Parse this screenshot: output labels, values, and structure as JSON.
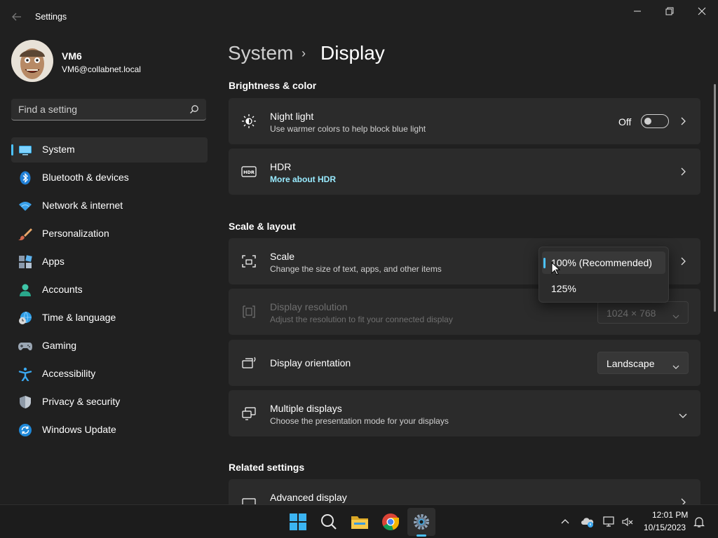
{
  "window": {
    "title": "Settings"
  },
  "profile": {
    "name": "VM6",
    "email": "VM6@collabnet.local"
  },
  "search": {
    "placeholder": "Find a setting",
    "icon": "search-icon"
  },
  "nav": {
    "items": [
      {
        "label": "System",
        "icon": "system-icon",
        "active": true
      },
      {
        "label": "Bluetooth & devices",
        "icon": "bluetooth-icon"
      },
      {
        "label": "Network & internet",
        "icon": "wifi-icon"
      },
      {
        "label": "Personalization",
        "icon": "brush-icon"
      },
      {
        "label": "Apps",
        "icon": "apps-icon"
      },
      {
        "label": "Accounts",
        "icon": "person-icon"
      },
      {
        "label": "Time & language",
        "icon": "globe-clock-icon"
      },
      {
        "label": "Gaming",
        "icon": "gamepad-icon"
      },
      {
        "label": "Accessibility",
        "icon": "accessibility-icon"
      },
      {
        "label": "Privacy & security",
        "icon": "shield-icon"
      },
      {
        "label": "Windows Update",
        "icon": "update-icon"
      }
    ]
  },
  "breadcrumb": {
    "parent": "System",
    "separator": "›",
    "current": "Display"
  },
  "sections": {
    "brightness": "Brightness & color",
    "scale_layout": "Scale & layout",
    "related": "Related settings"
  },
  "cards": {
    "night_light": {
      "title": "Night light",
      "subtitle": "Use warmer colors to help block blue light",
      "state": "Off",
      "toggle_on": false
    },
    "hdr": {
      "title": "HDR",
      "link": "More about HDR"
    },
    "scale": {
      "title": "Scale",
      "subtitle": "Change the size of text, apps, and other items"
    },
    "resolution": {
      "title": "Display resolution",
      "subtitle": "Adjust the resolution to fit your connected display",
      "value": "1024 × 768"
    },
    "orientation": {
      "title": "Display orientation",
      "value": "Landscape"
    },
    "multiple": {
      "title": "Multiple displays",
      "subtitle": "Choose the presentation mode for your displays"
    },
    "advanced": {
      "title": "Advanced display"
    }
  },
  "scale_menu": {
    "options": [
      "100% (Recommended)",
      "125%"
    ],
    "selected": "100% (Recommended)"
  },
  "taskbar": {
    "apps": [
      "start-icon",
      "search-icon",
      "file-explorer-icon",
      "chrome-icon",
      "settings-icon"
    ],
    "time": "12:01 PM",
    "date": "10/15/2023"
  },
  "colors": {
    "accent": "#4cc2ff",
    "background": "#202020",
    "card": "#2b2b2b",
    "link": "#99ebff"
  }
}
